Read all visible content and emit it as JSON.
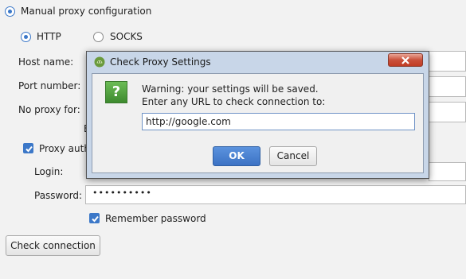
{
  "proxy": {
    "manual_label": "Manual proxy configuration",
    "http_label": "HTTP",
    "socks_label": "SOCKS",
    "host_label": "Host name:",
    "port_label": "Port number:",
    "no_proxy_label": "No proxy for:",
    "truncated_char": "E",
    "auth_label": "Proxy authe",
    "login_label": "Login:",
    "password_label": "Password:",
    "password_value": "••••••••••",
    "remember_label": "Remember password",
    "check_button": "Check connection"
  },
  "dialog": {
    "title": "Check Proxy Settings",
    "warning_line1": "Warning: your settings will be saved.",
    "warning_line2": "Enter any URL to check connection to:",
    "url_value": "http://google.com",
    "ok_label": "OK",
    "cancel_label": "Cancel",
    "question_glyph": "?"
  },
  "colors": {
    "accent": "#3c78c8",
    "ok_button": "#4a82d2",
    "close_button": "#c9503b",
    "question_icon": "#4a9a3a"
  }
}
